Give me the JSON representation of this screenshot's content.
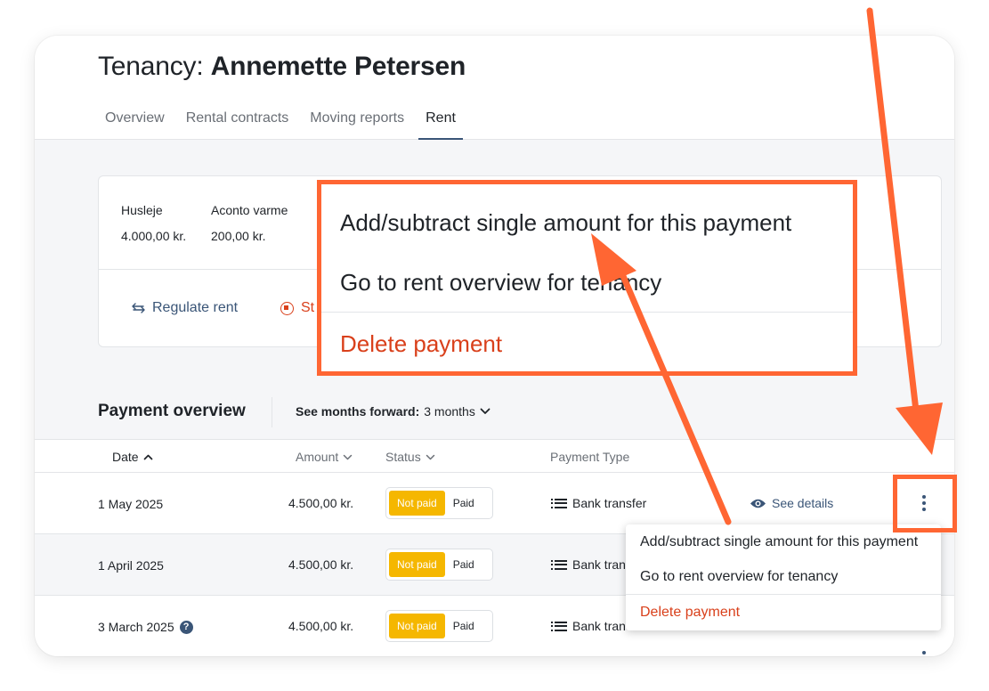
{
  "header": {
    "title_prefix": "Tenancy:",
    "title_name": "Annemette Petersen",
    "tabs": [
      {
        "label": "Overview"
      },
      {
        "label": "Rental contracts"
      },
      {
        "label": "Moving reports"
      },
      {
        "label": "Rent",
        "active": true
      }
    ]
  },
  "summary": {
    "fees": [
      {
        "label": "Husleje",
        "value": "4.000,00 kr."
      },
      {
        "label": "Aconto varme",
        "value": "200,00 kr."
      }
    ],
    "actions": {
      "regulate": "Regulate rent",
      "stop": "St"
    }
  },
  "payment_overview": {
    "title": "Payment overview",
    "months_label": "See months forward:",
    "months_value": "3 months",
    "columns": {
      "date": "Date",
      "amount": "Amount",
      "status": "Status",
      "payment_type": "Payment Type"
    },
    "rows": [
      {
        "date": "1 May 2025",
        "amount": "4.500,00 kr.",
        "status_on": "Not paid",
        "status_off": "Paid",
        "payment_type": "Bank transfer",
        "details": "See details"
      },
      {
        "date": "1 April 2025",
        "amount": "4.500,00 kr.",
        "status_on": "Not paid",
        "status_off": "Paid",
        "payment_type": "Bank tran"
      },
      {
        "date": "3 March 2025",
        "amount": "4.500,00 kr.",
        "status_on": "Not paid",
        "status_off": "Paid",
        "payment_type": "Bank tran",
        "help": "?"
      }
    ]
  },
  "menu": {
    "add_subtract": "Add/subtract single amount for this payment",
    "go_to_overview": "Go to rent overview for tenancy",
    "delete": "Delete payment"
  },
  "zoom_menu": {
    "add_subtract": "Add/subtract single amount for this payment",
    "go_to_overview": "Go to rent overview for tenancy",
    "delete": "Delete payment"
  },
  "colors": {
    "accent": "#3a5577",
    "danger": "#d9401b",
    "not_paid": "#f5b700",
    "annotation": "#ff6633"
  }
}
